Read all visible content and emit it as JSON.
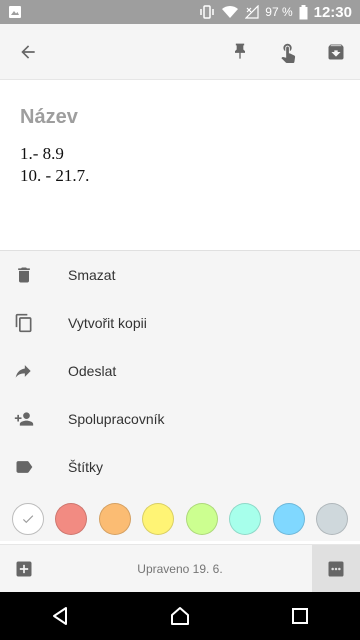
{
  "status_bar": {
    "battery_percent": "97 %",
    "time": "12:30"
  },
  "app_bar": {
    "back_icon": "arrow-back-icon",
    "pin_icon": "pin-icon",
    "reminder_icon": "reminder-touch-icon",
    "archive_icon": "archive-icon"
  },
  "note": {
    "title": "Název",
    "lines": [
      "1.- 8.9",
      "10. - 21.7."
    ]
  },
  "menu": {
    "items": [
      {
        "icon": "trash-icon",
        "label": "Smazat"
      },
      {
        "icon": "copy-icon",
        "label": "Vytvořit kopii"
      },
      {
        "icon": "share-icon",
        "label": "Odeslat"
      },
      {
        "icon": "add-person-icon",
        "label": "Spolupracovník"
      },
      {
        "icon": "label-icon",
        "label": "Štítky"
      }
    ]
  },
  "colors": {
    "swatches": [
      "#ffffff",
      "#f28b82",
      "#fbbc73",
      "#fff475",
      "#ccff90",
      "#a7ffeb",
      "#80d8ff",
      "#cfd8dc"
    ],
    "selected_index": 0
  },
  "bottom_bar": {
    "add_icon": "add-box-icon",
    "edited_text": "Upraveno 19. 6.",
    "more_icon": "more-horizontal-icon"
  },
  "nav_bar": {
    "back": "nav-back-icon",
    "home": "nav-home-icon",
    "recents": "nav-recents-icon"
  }
}
